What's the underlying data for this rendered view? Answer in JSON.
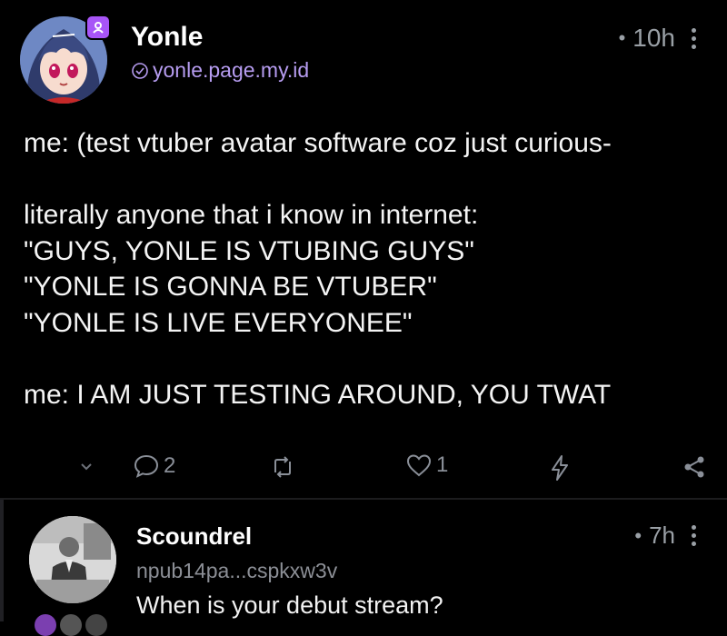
{
  "post": {
    "author_name": "Yonle",
    "nip05": "yonle.page.my.id",
    "time": "10h",
    "time_separator": "•",
    "lines": [
      "me: (test vtuber avatar software coz just curious-",
      "",
      "literally anyone that i know in internet:",
      "\"GUYS, YONLE IS VTUBING GUYS\"",
      "\"YONLE IS GONNA BE VTUBER\"",
      "\"YONLE IS LIVE EVERYONEE\"",
      "",
      "me: I AM JUST TESTING AROUND, YOU TWAT"
    ],
    "reply_count": "2",
    "like_count": "1"
  },
  "reply": {
    "author_name": "Scoundrel",
    "handle": "npub14pa...cspkxw3v",
    "time": "7h",
    "time_separator": "•",
    "text": "When is your debut stream?"
  },
  "colors": {
    "background": "#000000",
    "accent_purple": "#a855f7",
    "nip05_text": "#b69cf0",
    "muted": "#8a8f98"
  },
  "icons": [
    "verified-badge-icon",
    "at-check-icon",
    "kebab-menu-icon",
    "chevron-down-icon",
    "reply-icon",
    "repost-icon",
    "heart-icon",
    "zap-icon",
    "share-icon"
  ]
}
